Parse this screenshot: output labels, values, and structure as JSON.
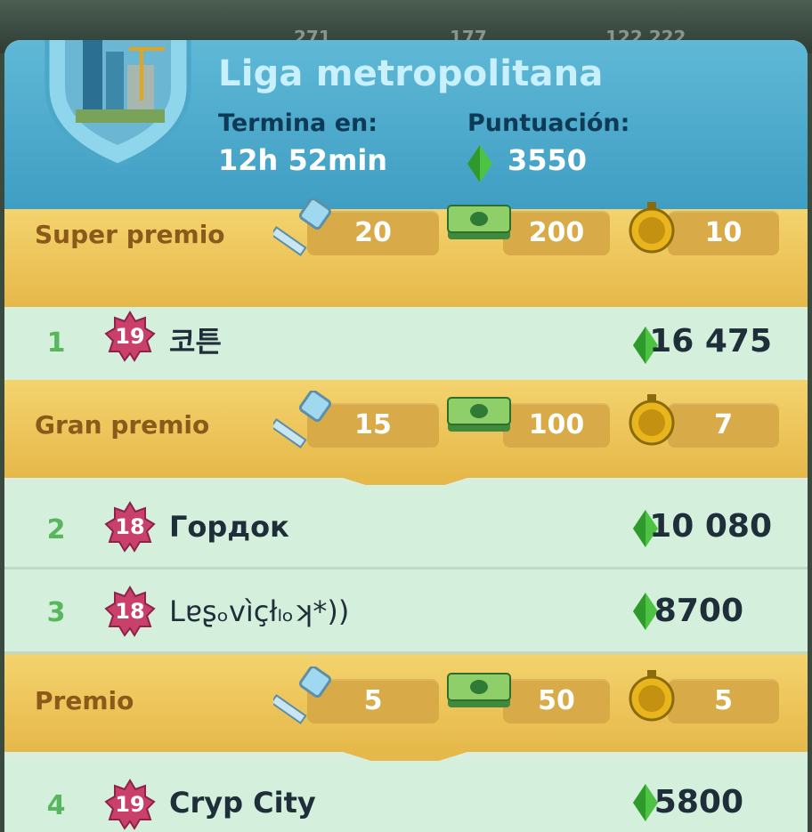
{
  "background": {
    "stats": [
      "271",
      "177",
      "122 222"
    ]
  },
  "header": {
    "title": "Liga metropolitana",
    "ends_label": "Termina en:",
    "ends_value": "12h 52min",
    "score_label": "Puntuación:",
    "score_value": "3550"
  },
  "tiers": [
    {
      "name": "Super premio",
      "keys": "20",
      "cash": "200",
      "speedups": "10"
    },
    {
      "name": "Gran premio",
      "keys": "15",
      "cash": "100",
      "speedups": "7"
    },
    {
      "name": "Premio",
      "keys": "5",
      "cash": "50",
      "speedups": "5"
    }
  ],
  "players": [
    {
      "rank": "1",
      "level": "19",
      "name": "코튼",
      "score": "16 475"
    },
    {
      "rank": "2",
      "level": "18",
      "name": "Гордок",
      "score": "10 080"
    },
    {
      "rank": "3",
      "level": "18",
      "name": "Lɐʂₒvìçłₗₒʞ*))",
      "score": "8700"
    },
    {
      "rank": "4",
      "level": "19",
      "name": "Cryp City",
      "score": "5800"
    }
  ],
  "colors": {
    "header": "#4aaacd",
    "tier": "#edc65a",
    "row": "#d5efdd",
    "rank": "#58b65d",
    "level_badge": "#c9406b"
  }
}
